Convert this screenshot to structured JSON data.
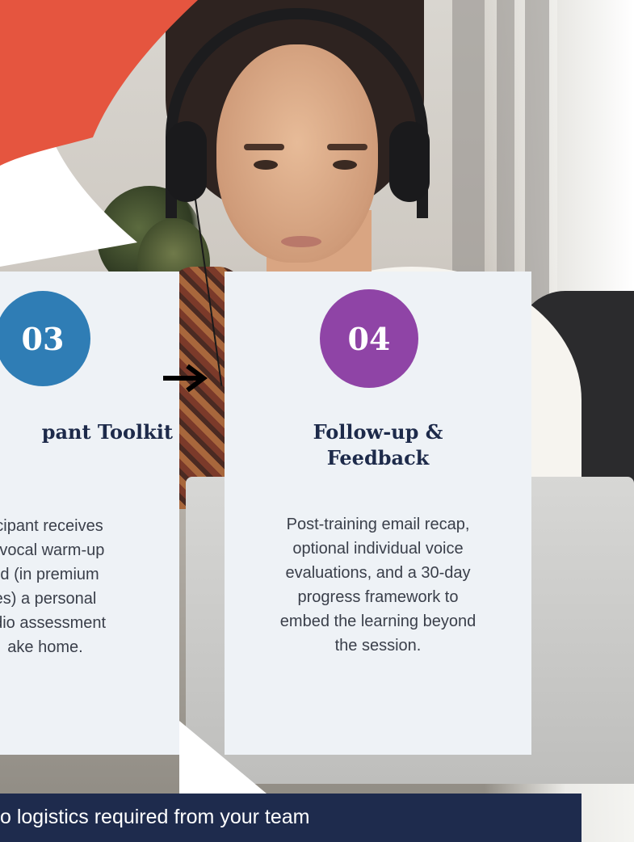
{
  "cards": [
    {
      "number": "03",
      "title": "pant Toolkit",
      "body_lines": [
        "ticipant receives",
        "a vocal warm-up",
        "nd (in premium",
        "es) a personal",
        "udio assessment",
        "ake home."
      ]
    },
    {
      "number": "04",
      "title_lines": [
        "Follow-up &",
        "Feedback"
      ],
      "body_lines": [
        "Post-training email recap,",
        "optional individual voice",
        "evaluations, and a 30-day",
        "progress framework to",
        "embed the learning beyond",
        "the session."
      ]
    }
  ],
  "banner": {
    "text": "o logistics required from your team"
  },
  "icons": {
    "step_arrow": "right-arrow-icon"
  },
  "colors": {
    "accent_red": "#e5553f",
    "badge_blue": "#2f7db5",
    "badge_purple": "#8f44a6",
    "card_bg": "#eef2f6",
    "title_navy": "#1d2a4a",
    "banner_navy": "#1e2b4d"
  }
}
